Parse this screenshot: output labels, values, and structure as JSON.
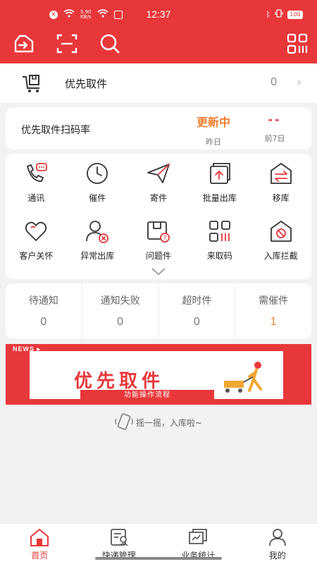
{
  "status": {
    "time": "12:37",
    "speed": "5.90",
    "speed_unit": "KB/s",
    "battery": "100"
  },
  "toolbar": {
    "login_icon": "sign-in-icon",
    "scan_icon": "scan-icon",
    "search_icon": "search-icon",
    "qrcode_icon": "qr-code-icon"
  },
  "priority": {
    "label": "优先取件",
    "count": "0"
  },
  "scan_rate": {
    "title": "优先取件扫码率",
    "yesterday_value": "更新中",
    "yesterday_label": "昨日",
    "week_value": "--",
    "week_label": "前7日"
  },
  "grid": [
    {
      "label": "通讯",
      "icon": "phone-chat-icon"
    },
    {
      "label": "催件",
      "icon": "clock-icon"
    },
    {
      "label": "寄件",
      "icon": "paper-plane-icon"
    },
    {
      "label": "批量出库",
      "icon": "batch-out-icon"
    },
    {
      "label": "移库",
      "icon": "transfer-icon"
    },
    {
      "label": "客户关怀",
      "icon": "heart-icon"
    },
    {
      "label": "异常出库",
      "icon": "user-error-icon"
    },
    {
      "label": "问题件",
      "icon": "problem-package-icon"
    },
    {
      "label": "来取码",
      "icon": "pickup-code-icon"
    },
    {
      "label": "入库拦截",
      "icon": "intercept-icon"
    }
  ],
  "stats": [
    {
      "label": "待通知",
      "value": "0"
    },
    {
      "label": "通知失败",
      "value": "0"
    },
    {
      "label": "超时件",
      "value": "0"
    },
    {
      "label": "需催件",
      "value": "1"
    }
  ],
  "banner": {
    "tag": "NEWS ▸",
    "title": "优先取件",
    "subtitle": "功能操作流程"
  },
  "shake": {
    "text": "摇一摇，入库啦~"
  },
  "nav": [
    {
      "label": "首页",
      "active": true
    },
    {
      "label": "快递管理",
      "active": false
    },
    {
      "label": "业务统计",
      "active": false
    },
    {
      "label": "我的",
      "active": false
    }
  ],
  "colors": {
    "brand": "#e8373a",
    "accent": "#f07d2e"
  }
}
